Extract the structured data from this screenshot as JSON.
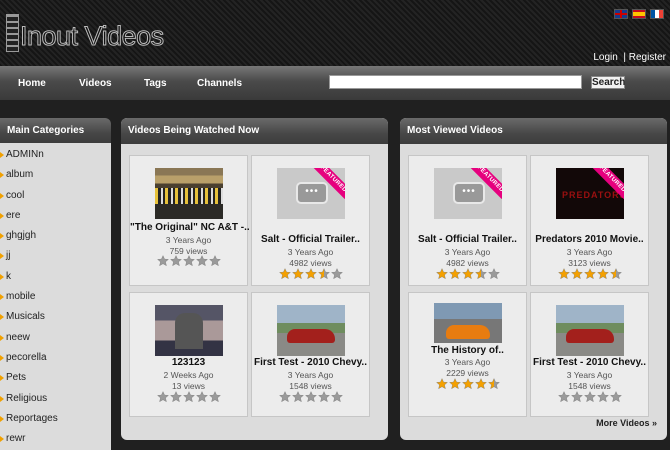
{
  "site": {
    "logo_text": "Inout Videos"
  },
  "colors": {
    "accent_featured": "#e6007e",
    "star_on": "#f4a000",
    "star_off": "#9a9a9a",
    "bullet": "#f0a000"
  },
  "user_links": {
    "login": "Login",
    "separator": "|",
    "register": "Register"
  },
  "nav": {
    "home": "Home",
    "videos": "Videos",
    "tags": "Tags",
    "channels": "Channels"
  },
  "search": {
    "button": "Search",
    "value": ""
  },
  "sidebar": {
    "title": "Main Categories",
    "items": [
      "ADMINn",
      "album",
      "cool",
      "ere",
      "ghgjgh",
      "jj",
      "k",
      "mobile",
      "Musicals",
      "neew",
      "pecorella",
      "Pets",
      "Religious",
      "Reportages",
      "rewr"
    ]
  },
  "watched": {
    "title": "Videos Being Watched Now",
    "videos": [
      {
        "title": "\"The Original\" NC A&T -..",
        "age": "3 Years Ago",
        "views": "759 views",
        "rating": 0,
        "featured": false
      },
      {
        "title": "Salt - Official Trailer..",
        "age": "3 Years Ago",
        "views": "4982 views",
        "rating": 3.5,
        "featured": true,
        "ribbon": "FEATURED"
      },
      {
        "title": "123123",
        "age": "2 Weeks Ago",
        "views": "13 views",
        "rating": 0,
        "featured": false
      },
      {
        "title": "First Test - 2010 Chevy..",
        "age": "3 Years Ago",
        "views": "1548 views",
        "rating": 0,
        "featured": false
      }
    ]
  },
  "viewed": {
    "title": "Most Viewed Videos",
    "more": "More Videos »",
    "videos": [
      {
        "title": "Salt - Official Trailer..",
        "age": "3 Years Ago",
        "views": "4982 views",
        "rating": 3.5,
        "featured": true,
        "ribbon": "FEATURED"
      },
      {
        "title": "Predators 2010 Movie..",
        "age": "3 Years Ago",
        "views": "3123 views",
        "rating": 4.5,
        "featured": true,
        "ribbon": "FEATURED",
        "thumb_text": "PREDATORS"
      },
      {
        "title": "The History of..",
        "age": "3 Years Ago",
        "views": "2229 views",
        "rating": 4.5,
        "featured": false
      },
      {
        "title": "First Test - 2010 Chevy..",
        "age": "3 Years Ago",
        "views": "1548 views",
        "rating": 0,
        "featured": false
      }
    ]
  }
}
